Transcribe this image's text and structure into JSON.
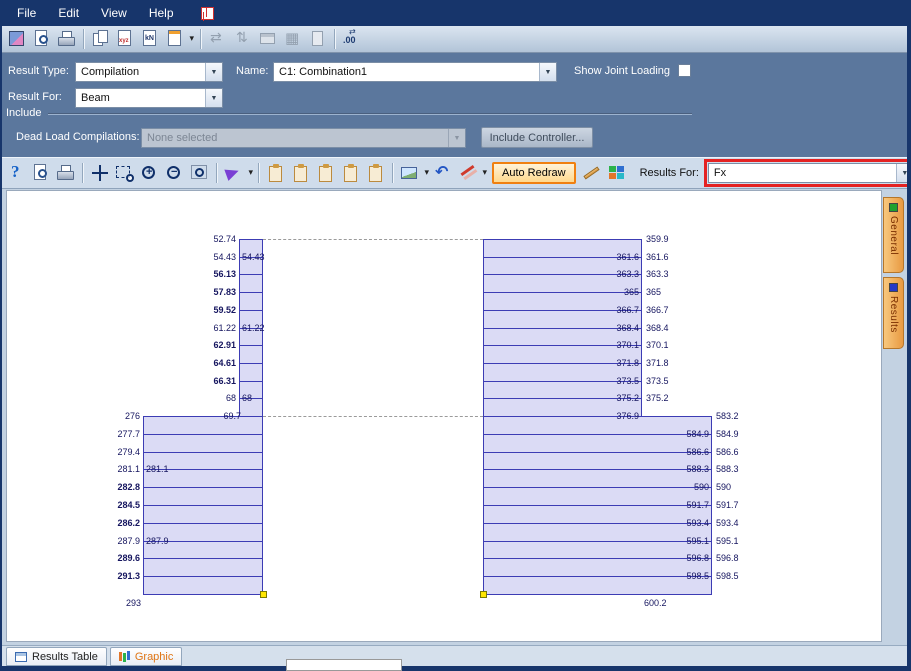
{
  "menu": {
    "items": [
      "File",
      "Edit",
      "View",
      "Help"
    ]
  },
  "toolbars": {
    "main": [
      "model-view",
      "print-preview",
      "print",
      "|",
      "copy",
      "export-xyz",
      "units",
      "new-view-dropdown",
      "|",
      "flip-h-disabled",
      "flip-v-disabled",
      "window-disabled",
      "table-disabled",
      "doc-disabled",
      "|",
      "decimal-places"
    ],
    "graphics_left": [
      "help",
      "print-preview",
      "print",
      "|",
      "pan",
      "zoom-window",
      "zoom-in",
      "zoom-out",
      "zoom-extents",
      "|",
      "redraw-dropdown",
      "|",
      "clipboard-copy",
      "clipboard-paste",
      "clipboard-view",
      "clipboard-save",
      "clipboard-report",
      "|",
      "image-dropdown",
      "undo",
      "annotate-dropdown"
    ],
    "graphics_right": [
      "draw-pen",
      "color-grid"
    ]
  },
  "results_panel": {
    "result_type_label": "Result Type:",
    "result_type_value": "Compilation",
    "name_label": "Name:",
    "name_value": "C1: Combination1",
    "show_joint_loading_label": "Show Joint Loading",
    "result_for_label": "Result For:",
    "result_for_value": "Beam",
    "include_label": "Include",
    "dead_load_label": "Dead Load Compilations:",
    "dead_load_value": "None selected",
    "include_controller_label": "Include Controller..."
  },
  "graphics_toolbar": {
    "auto_redraw_label": "Auto Redraw",
    "results_for_label": "Results For:",
    "results_for_value": "Fx"
  },
  "side_tabs": {
    "general": {
      "label": "General",
      "color": "#1fa12e"
    },
    "results": {
      "label": "Results",
      "color": "#2438c8"
    }
  },
  "bottom_tabs": {
    "results_table": "Results Table",
    "graphic": "Graphic"
  },
  "colors": {
    "bar_fill": "#dbdbf5",
    "bar_border": "#3c3cb4",
    "highlight_red": "#e42222",
    "accent_orange": "#f08010"
  },
  "diagram": {
    "left": {
      "upper_rows": [
        {
          "out": "52.74"
        },
        {
          "out": "54.43",
          "in": "54.43"
        },
        {
          "out": "56.13",
          "b": true
        },
        {
          "out": "57.83",
          "b": true
        },
        {
          "out": "59.52",
          "b": true
        },
        {
          "out": "61.22",
          "in": "61.22"
        },
        {
          "out": "62.91",
          "b": true
        },
        {
          "out": "64.61",
          "b": true
        },
        {
          "out": "66.31",
          "b": true
        },
        {
          "out": "68",
          "in": "68"
        }
      ],
      "transition": {
        "out": "276",
        "in": "69.7"
      },
      "lower_rows": [
        {
          "out": "277.7"
        },
        {
          "out": "279.4"
        },
        {
          "out": "281.1",
          "in": "281.1"
        },
        {
          "out": "282.8",
          "b": true
        },
        {
          "out": "284.5",
          "b": true
        },
        {
          "out": "286.2",
          "b": true
        },
        {
          "out": "287.9",
          "in": "287.9"
        },
        {
          "out": "289.6",
          "b": true
        },
        {
          "out": "291.3",
          "b": true
        }
      ],
      "bottom": "293"
    },
    "right": {
      "upper_rows": [
        {
          "out": "359.9"
        },
        {
          "out": "361.6",
          "in": "361.6"
        },
        {
          "out": "363.3",
          "in": "363.3"
        },
        {
          "out": "365",
          "in": "365"
        },
        {
          "out": "366.7",
          "in": "366.7"
        },
        {
          "out": "368.4",
          "in": "368.4"
        },
        {
          "out": "370.1",
          "in": "370.1"
        },
        {
          "out": "371.8",
          "in": "371.8"
        },
        {
          "out": "373.5",
          "in": "373.5"
        },
        {
          "out": "375.2",
          "in": "375.2"
        }
      ],
      "transition": {
        "out": "583.2",
        "in": "376.9"
      },
      "lower_rows": [
        {
          "out": "584.9",
          "in": "584.9"
        },
        {
          "out": "586.6",
          "in": "586.6"
        },
        {
          "out": "588.3",
          "in": "588.3"
        },
        {
          "out": "590",
          "in": "590"
        },
        {
          "out": "591.7",
          "in": "591.7"
        },
        {
          "out": "593.4",
          "in": "593.4"
        },
        {
          "out": "595.1",
          "in": "595.1"
        },
        {
          "out": "596.8",
          "in": "596.8"
        },
        {
          "out": "598.5",
          "in": "598.5"
        }
      ],
      "bottom": "600.2"
    }
  }
}
